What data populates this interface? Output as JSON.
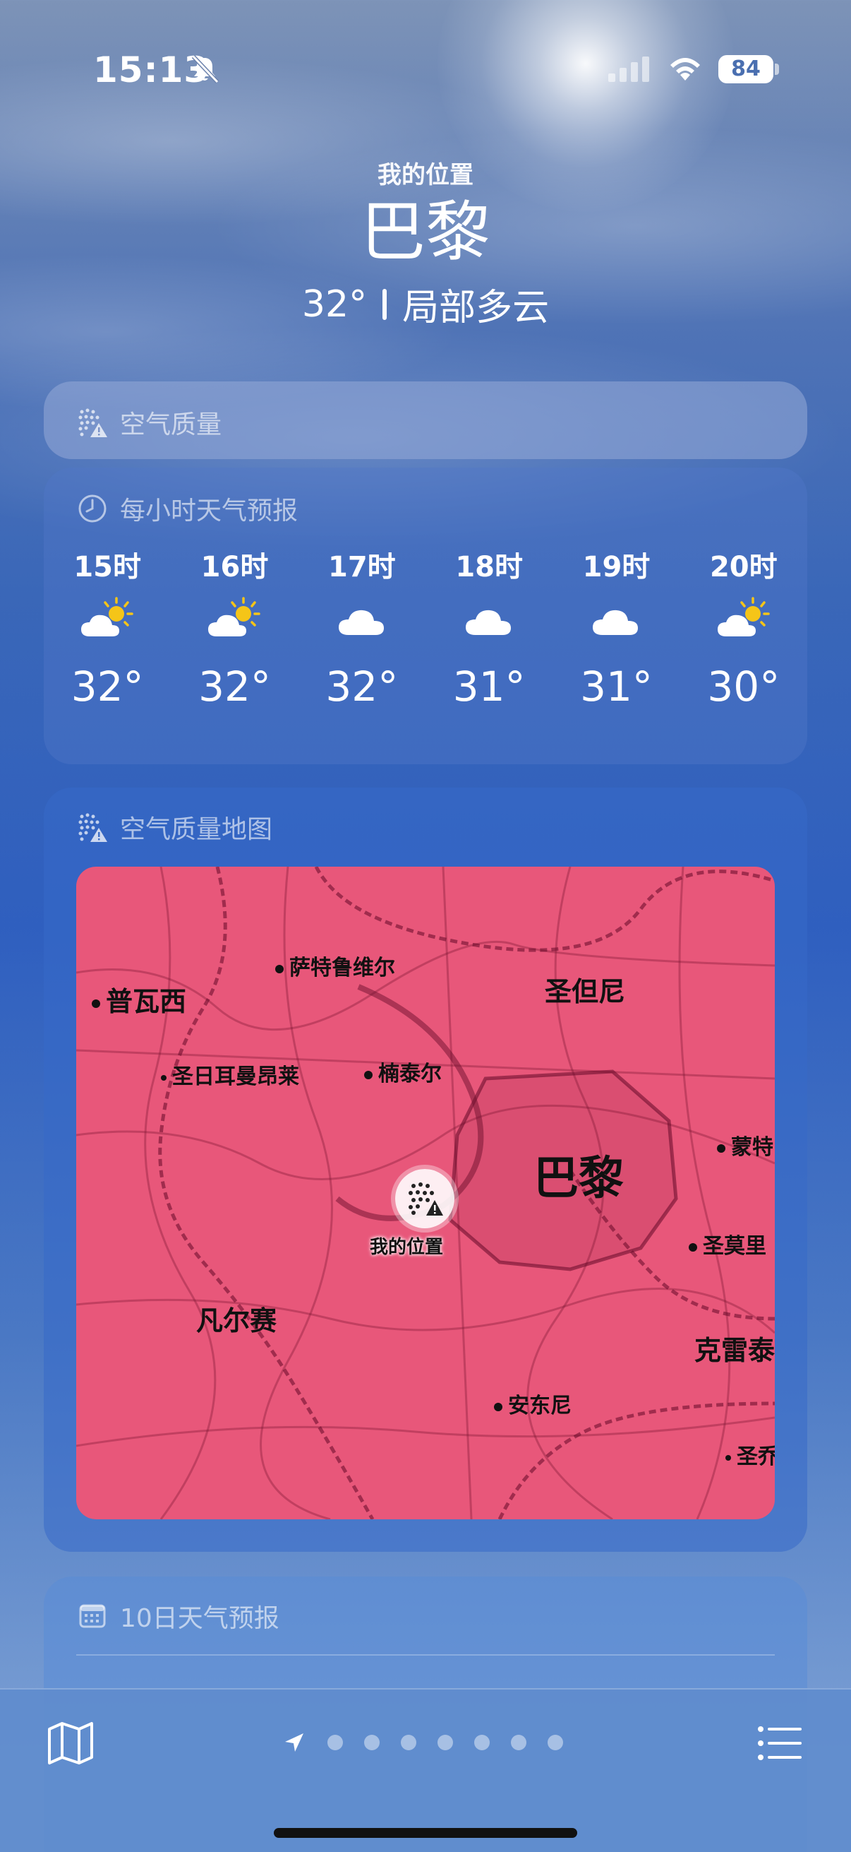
{
  "status_bar": {
    "time": "15:13",
    "battery": "84",
    "icons": [
      "bell-slash-icon",
      "cellular-signal-icon",
      "wifi-icon",
      "battery-icon"
    ]
  },
  "header": {
    "location_label": "我的位置",
    "city": "巴黎",
    "temperature": "32°",
    "condition": "局部多云"
  },
  "air_quality": {
    "title": "空气质量",
    "icon": "air-quality-warning-icon"
  },
  "hourly": {
    "title": "每小时天气预报",
    "icon": "clock-icon",
    "items": [
      {
        "time": "15时",
        "icon": "partly-cloudy-sun-icon",
        "temp": "32°"
      },
      {
        "time": "16时",
        "icon": "partly-cloudy-sun-icon",
        "temp": "32°"
      },
      {
        "time": "17时",
        "icon": "cloud-icon",
        "temp": "32°"
      },
      {
        "time": "18时",
        "icon": "cloud-icon",
        "temp": "31°"
      },
      {
        "time": "19时",
        "icon": "cloud-icon",
        "temp": "31°"
      },
      {
        "time": "20时",
        "icon": "partly-cloudy-sun-icon",
        "temp": "30°"
      }
    ]
  },
  "aq_map": {
    "title": "空气质量地图",
    "icon": "air-quality-warning-icon",
    "map_color": "#e8577a",
    "places": {
      "poissy": "普瓦西",
      "sartrouville": "萨特鲁维尔",
      "saint_denis": "圣但尼",
      "saint_germain": "圣日耳曼昂莱",
      "nanterre": "楠泰尔",
      "paris": "巴黎",
      "montreuil": "蒙特",
      "my_location": "我的位置",
      "saint_maur": "圣莫里",
      "versailles": "凡尔赛",
      "creteil": "克雷泰",
      "antony": "安东尼",
      "saint_genevieve": "圣乔"
    }
  },
  "ten_day": {
    "title": "10日天气预报",
    "icon": "calendar-icon"
  },
  "bottom_bar": {
    "left_icon": "map-icon",
    "right_icon": "list-icon",
    "page_count": 7,
    "current_page_icon": "location-arrow-icon"
  }
}
